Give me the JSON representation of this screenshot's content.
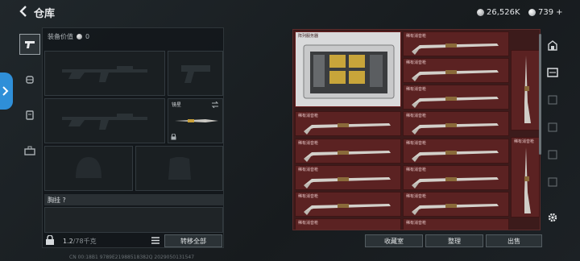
{
  "header": {
    "title": "仓库"
  },
  "currency": {
    "silver": "26,526K",
    "gold": "739",
    "plus": "+"
  },
  "equipment": {
    "value_label": "装备价值",
    "value_amount": "0",
    "attachment_label": "镜星",
    "chest_label": "胸挂",
    "chest_hint": "?",
    "capacity": "1.2",
    "capacity_max": "/78千克",
    "transfer_all": "转移全部"
  },
  "storage": {
    "server_label": "阵列服务器",
    "item_label": "稀有消音枪",
    "buttons": {
      "collect": "收藏室",
      "sort": "整理",
      "sell": "出售"
    }
  },
  "status": {
    "text": "CN 00:18B1 9789E21988518382Q 2029050131547"
  },
  "colors": {
    "accent": "#2f8fd8",
    "grid_bg": "#5b2222",
    "grid_border": "#3e1515"
  }
}
